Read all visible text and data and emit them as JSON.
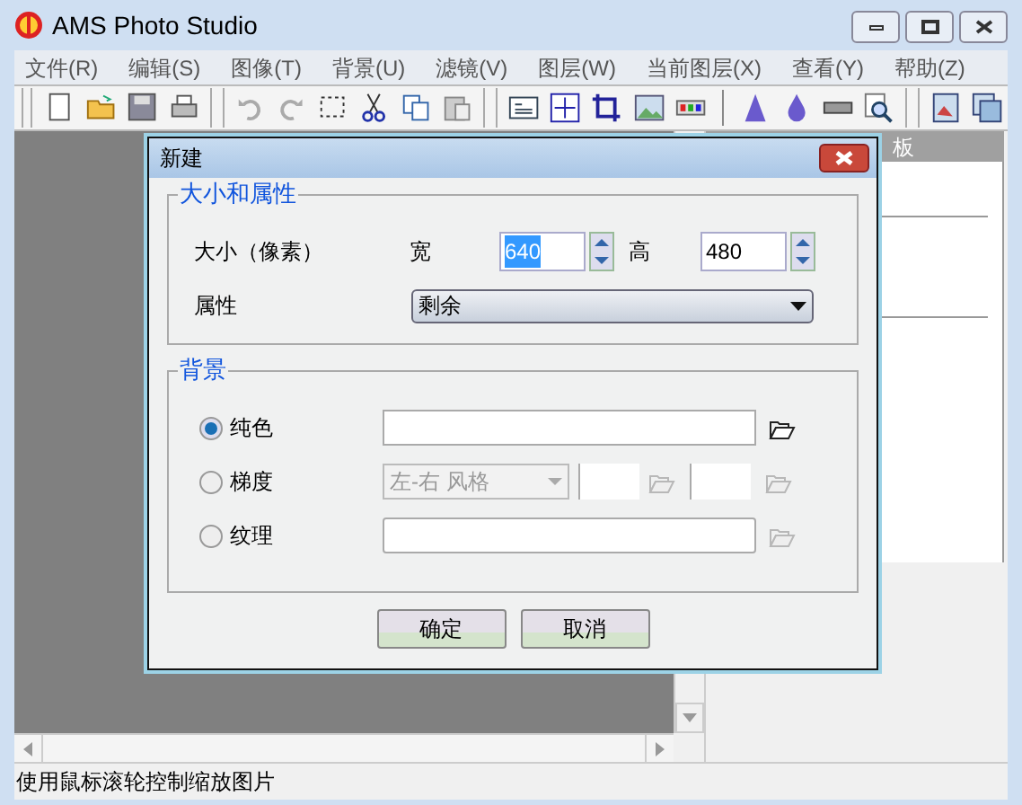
{
  "window": {
    "title": "AMS Photo Studio"
  },
  "menu": [
    "文件(R)",
    "编辑(S)",
    "图像(T)",
    "背景(U)",
    "滤镜(V)",
    "图层(W)",
    "当前图层(X)",
    "查看(Y)",
    "帮助(Z)"
  ],
  "panel": {
    "title": "板"
  },
  "dialog": {
    "title": "新建",
    "size_group": {
      "title": "大小和属性",
      "size_label": "大小（像素）",
      "width_label": "宽",
      "width_value": "640",
      "width_highlighted": true,
      "height_label": "高",
      "height_value": "480",
      "height_highlighted": false,
      "attr_label": "属性",
      "attr_value": "剩余"
    },
    "background_group": {
      "title": "背景",
      "options": [
        {
          "kind": "solid",
          "label": "纯色",
          "selected": true,
          "disabled": false
        },
        {
          "kind": "gradient",
          "label": "梯度",
          "selected": false,
          "disabled": true,
          "style_value": "左-右 风格"
        },
        {
          "kind": "texture",
          "label": "纹理",
          "selected": false,
          "disabled": true
        }
      ]
    },
    "buttons": [
      "确定",
      "取消"
    ]
  },
  "status_bar": "使用鼠标滚轮控制缩放图片"
}
